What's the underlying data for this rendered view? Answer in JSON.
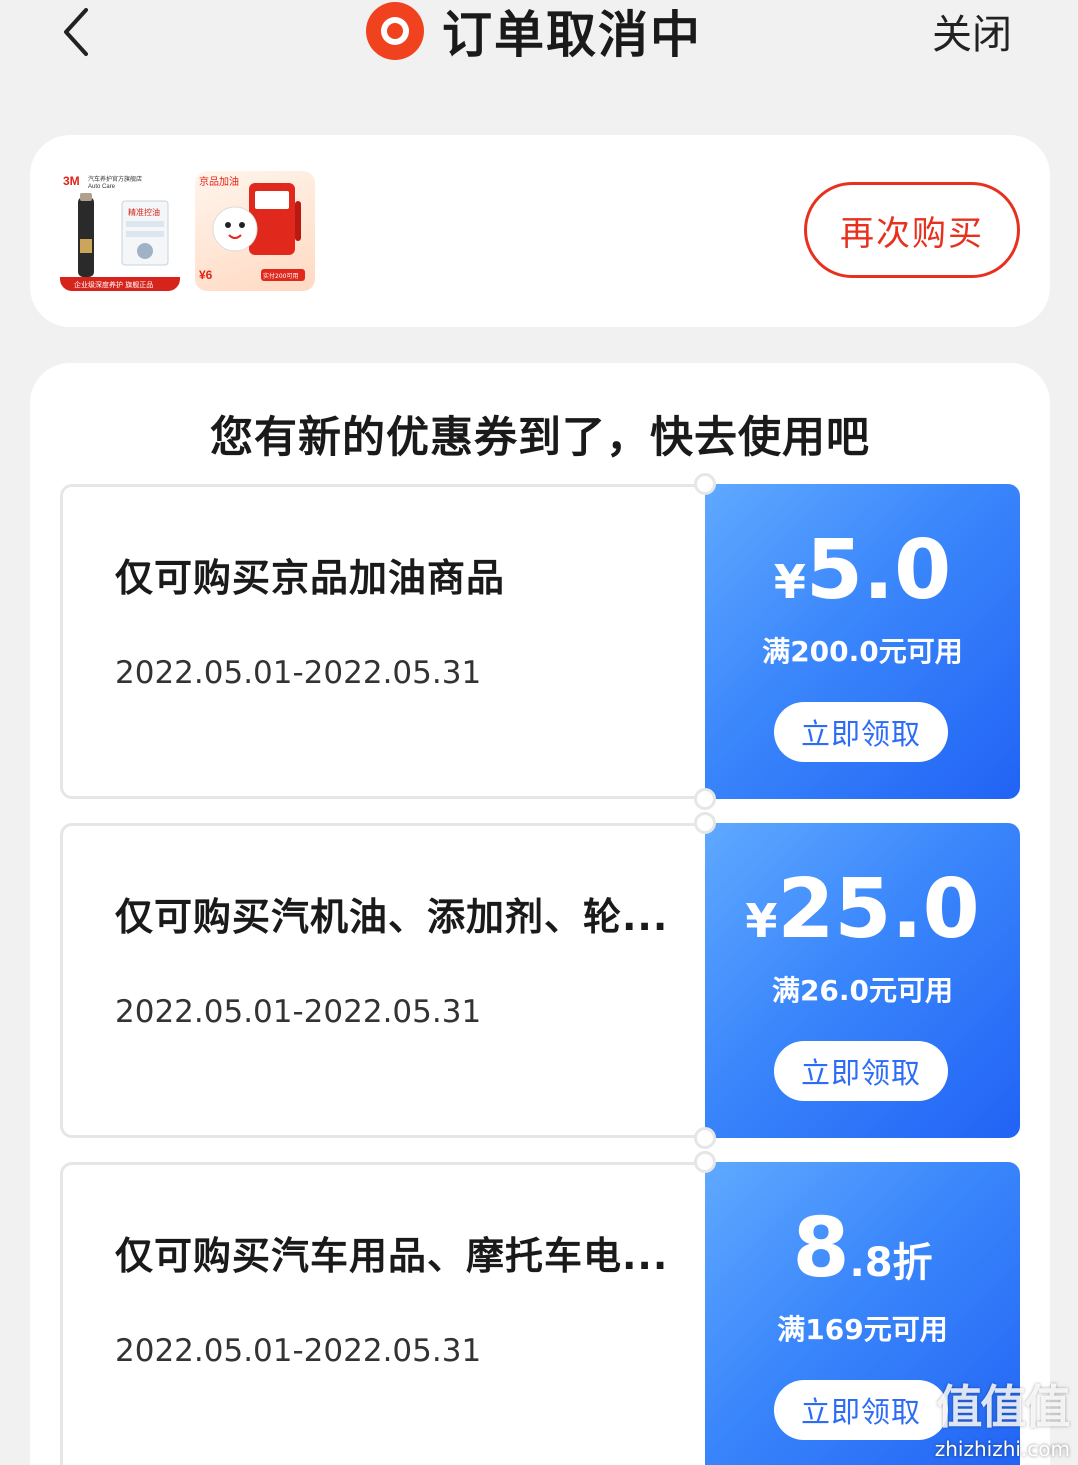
{
  "header": {
    "title": "订单取消中",
    "close_label": "关闭",
    "status_color": "#f0421f"
  },
  "order": {
    "products": [
      {
        "icon": "product-3m-oil-additive-image",
        "brand": "3M",
        "store_text": "汽车养护官方旗舰店",
        "sub": "Auto Care",
        "badge": "精准控油",
        "footer": "企业级深度养护 旗舰正品"
      },
      {
        "icon": "product-jd-fuel-image",
        "brand": "京品加油",
        "price_hint": "¥6",
        "tag": "实付200可用"
      }
    ],
    "buy_again_label": "再次购买",
    "accent_color": "#e8301f"
  },
  "coupons": {
    "heading": "您有新的优惠券到了，快去使用吧",
    "items": [
      {
        "name": "仅可购买京品加油商品",
        "date": "2022.05.01-2022.05.31",
        "currency": "¥",
        "value_main": "5.0",
        "value_suffix": "",
        "condition": "满200.0元可用",
        "claim_label": "立即领取"
      },
      {
        "name": "仅可购买汽机油、添加剂、轮...",
        "date": "2022.05.01-2022.05.31",
        "currency": "¥",
        "value_main": "25.0",
        "value_suffix": "",
        "condition": "满26.0元可用",
        "claim_label": "立即领取"
      },
      {
        "name": "仅可购买汽车用品、摩托车电...",
        "date": "2022.05.01-2022.05.31",
        "currency": "",
        "value_main": "8",
        "value_suffix": ".8折",
        "condition": "满169元可用",
        "claim_label": "立即领取"
      }
    ],
    "coupon_color": "#3a86fb"
  },
  "watermark": {
    "main": "值值值",
    "sub": "zhizhizhi.com"
  }
}
